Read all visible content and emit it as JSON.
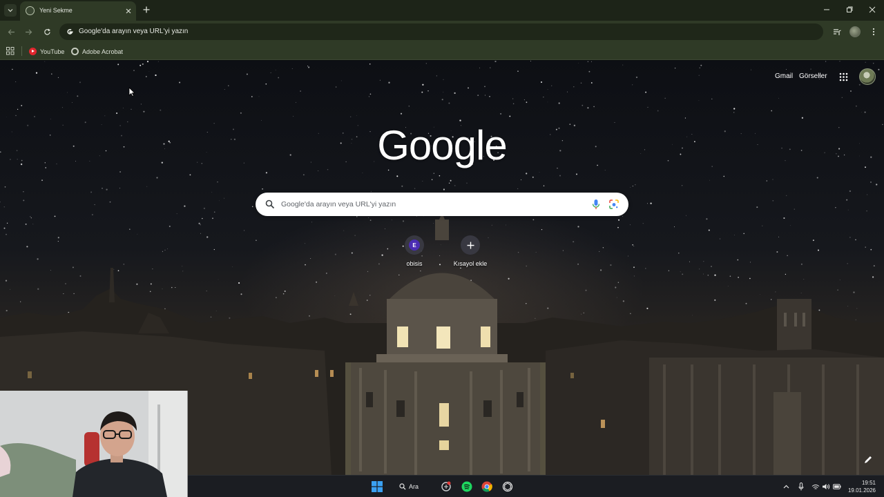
{
  "browser": {
    "tab": {
      "title": "Yeni Sekme"
    },
    "omnibox": {
      "text": "Google'da arayın veya URL'yi yazın"
    },
    "bookmarks": [
      {
        "label": "YouTube",
        "icon": "youtube-icon"
      },
      {
        "label": "Adobe Acrobat",
        "icon": "adobe-acrobat-icon"
      }
    ],
    "accent_color": "#2f3a26"
  },
  "ntp": {
    "links": {
      "gmail": "Gmail",
      "images": "Görseller"
    },
    "logo": "Google",
    "search_placeholder": "Google'da arayın veya URL'yi yazın",
    "shortcuts": [
      {
        "letter": "E",
        "label": "obisis"
      },
      {
        "letter": "+",
        "label": "Kısayol ekle"
      }
    ]
  },
  "taskbar": {
    "search_label": "Ara",
    "apps": [
      "windows-start-icon",
      "search-icon",
      "chatgpt-icon",
      "spotify-icon",
      "chrome-icon",
      "openai-icon"
    ],
    "clock": {
      "time": "19:51",
      "date": "19.01.2026"
    }
  }
}
